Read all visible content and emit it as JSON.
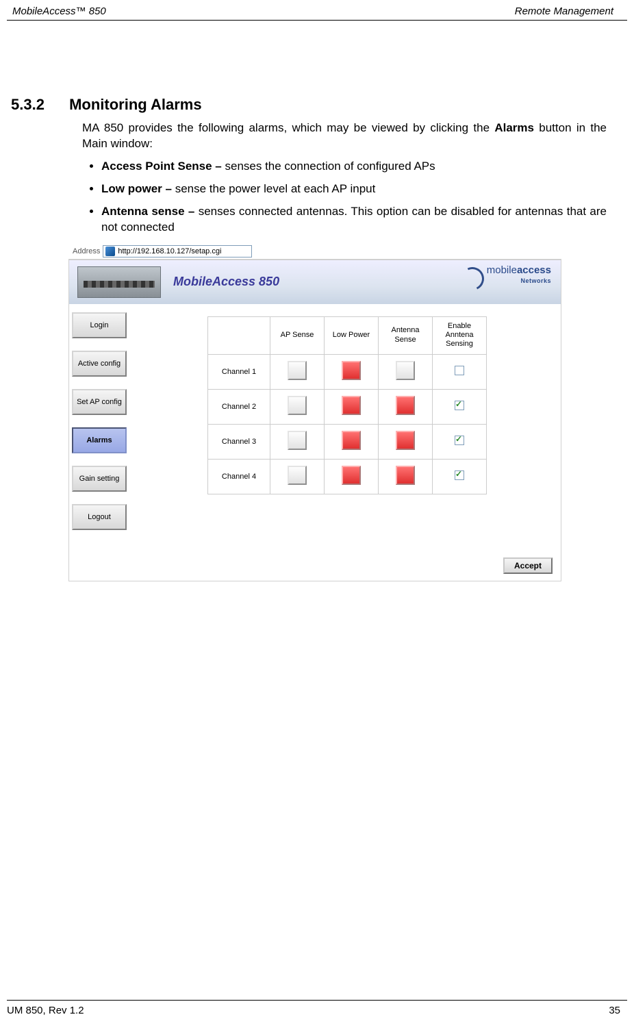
{
  "header": {
    "left": "MobileAccess™  850",
    "right": "Remote Management"
  },
  "section": {
    "number": "5.3.2",
    "title": "Monitoring Alarms"
  },
  "para1_a": "MA 850 provides the following alarms, which may be viewed by clicking the ",
  "para1_b": "Alarms",
  "para1_c": " button in the Main window:",
  "bullets": [
    {
      "bold": "Access Point Sense – ",
      "rest": "senses the connection of configured APs"
    },
    {
      "bold": "Low power – ",
      "rest": "sense the power level at each AP input"
    },
    {
      "bold": "Antenna sense – ",
      "rest": "senses connected antennas. This option can be disabled for antennas that are not connected"
    }
  ],
  "screenshot": {
    "address_label": "Address",
    "url": "http://192.168.10.127/setap.cgi",
    "banner_title": "MobileAccess 850",
    "logo_text": "mobile",
    "logo_bold": "access",
    "logo_sub": "Networks",
    "sidebar": [
      {
        "label": "Login",
        "active": false
      },
      {
        "label": "Active config",
        "active": false
      },
      {
        "label": "Set AP config",
        "active": false
      },
      {
        "label": "Alarms",
        "active": true
      },
      {
        "label": "Gain setting",
        "active": false
      },
      {
        "label": "Logout",
        "active": false
      }
    ],
    "table": {
      "headers": [
        "",
        "AP Sense",
        "Low Power",
        "Antenna Sense",
        "Enable Anntena Sensing"
      ],
      "rows": [
        {
          "label": "Channel 1",
          "ap": "gray",
          "low": "red",
          "ant": "gray",
          "enable": false
        },
        {
          "label": "Channel 2",
          "ap": "gray",
          "low": "red",
          "ant": "red",
          "enable": true
        },
        {
          "label": "Channel 3",
          "ap": "gray",
          "low": "red",
          "ant": "red",
          "enable": true
        },
        {
          "label": "Channel 4",
          "ap": "gray",
          "low": "red",
          "ant": "red",
          "enable": true
        }
      ]
    },
    "accept": "Accept"
  },
  "footer": {
    "left": "UM 850, Rev 1.2",
    "right": "35"
  }
}
